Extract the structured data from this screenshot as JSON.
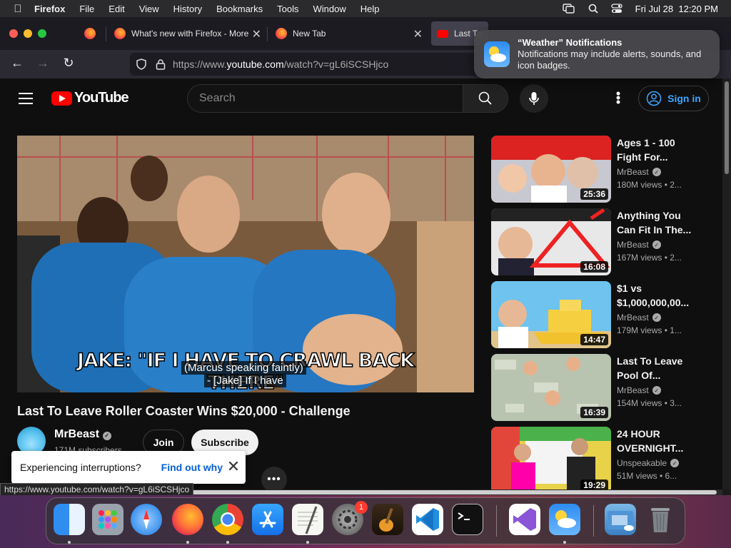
{
  "menubar": {
    "app": "Firefox",
    "items": [
      "File",
      "Edit",
      "View",
      "History",
      "Bookmarks",
      "Tools",
      "Window",
      "Help"
    ],
    "datetime": "Fri Jul 28  12:20 PM"
  },
  "tabs": [
    {
      "label": "What's new with Firefox - More"
    },
    {
      "label": "New Tab"
    },
    {
      "label": "Last To"
    }
  ],
  "urlbar": {
    "prefix": "https://www.",
    "domain": "youtube.com",
    "path": "/watch?v=gL6iSCSHjco"
  },
  "notification": {
    "title": "“Weather” Notifications",
    "body": "Notifications may include alerts, sounds, and icon badges."
  },
  "youtube": {
    "logo": "YouTube",
    "search_placeholder": "Search",
    "signin": "Sign in",
    "video": {
      "burned_caption": "JAKE: \"IF I HAVE TO CRAWL BACK THERE\"",
      "cc_line1": "(Marcus speaking faintly)",
      "cc_line2": "- [Jake] If I have",
      "title": "Last To Leave Roller Coaster Wins $20,000 - Challenge",
      "channel": "MrBeast",
      "subscribers": "171M subscribers",
      "join": "Join",
      "subscribe": "Subscribe"
    },
    "toast": {
      "message": "Experiencing interruptions?",
      "link": "Find out why"
    },
    "status_url": "https://www.youtube.com/watch?v=gL6iSCSHjco",
    "recommendations": [
      {
        "title": "Ages 1 - 100 Fight For...",
        "channel": "MrBeast",
        "meta": "180M views  • 2...",
        "duration": "25:36"
      },
      {
        "title": "Anything You Can Fit In The...",
        "channel": "MrBeast",
        "meta": "167M views  • 2...",
        "duration": "16:08"
      },
      {
        "title": "$1 vs $1,000,000,00...",
        "channel": "MrBeast",
        "meta": "179M views  • 1...",
        "duration": "14:47"
      },
      {
        "title": "Last To Leave Pool Of...",
        "channel": "MrBeast",
        "meta": "154M views  • 3...",
        "duration": "16:39"
      },
      {
        "title": "24 HOUR OVERNIGHT...",
        "channel": "Unspeakable",
        "meta": "51M views  • 6...",
        "duration": "19:29"
      }
    ]
  },
  "dock": {
    "settings_badge": "1",
    "apps": [
      "finder-icon",
      "launchpad-icon",
      "safari-icon",
      "firefox-icon",
      "chrome-icon",
      "app-store-icon",
      "textedit-icon",
      "system-settings-icon",
      "garageband-icon",
      "vscode-icon",
      "terminal-icon",
      "visual-studio-icon",
      "weather-icon",
      "downloads-folder-icon",
      "trash-icon"
    ]
  }
}
